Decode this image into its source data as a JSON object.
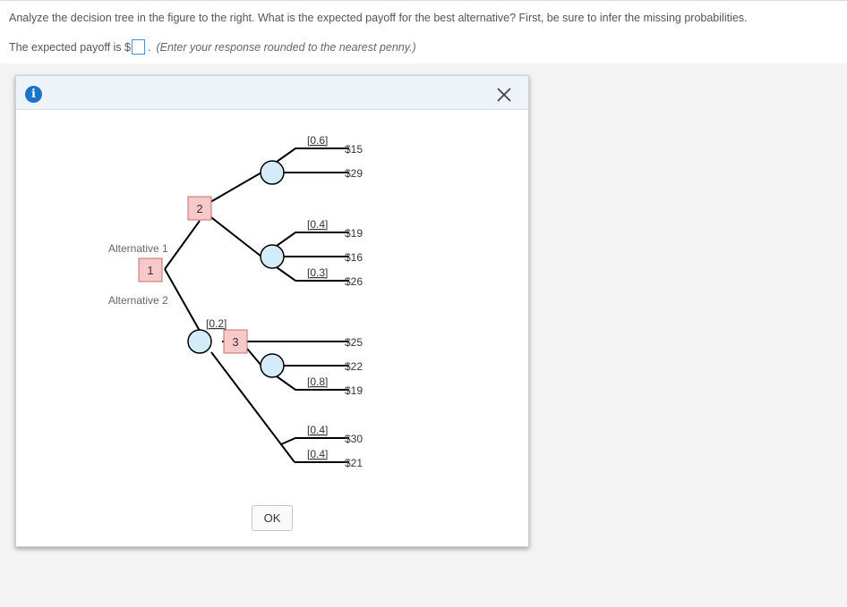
{
  "question": {
    "text": "Analyze the decision tree in the figure to the right. What is the expected payoff for the best alternative? First, be sure to infer the missing probabilities.",
    "answer_prefix": "The expected payoff is $",
    "answer_suffix": ".",
    "answer_value": "",
    "hint": "(Enter your response rounded to the nearest penny.)"
  },
  "dialog": {
    "info_icon_glyph": "i",
    "ok_label": "OK"
  },
  "tree": {
    "decision_nodes": {
      "node1": "1",
      "node2": "2",
      "node3": "3"
    },
    "alternatives": {
      "alt1": "Alternative 1",
      "alt2": "Alternative 2"
    },
    "probabilities": {
      "p_upper_top": "[0.6]",
      "p_middle_top": "[0.4]",
      "p_middle_bottom": "[0.3]",
      "p_alt2": "[0.2]",
      "p_node3_bottom": "[0.8]",
      "p_lower_top": "[0.4]",
      "p_lower_bottom": "[0.4]"
    },
    "payoffs": {
      "pay1": "$15",
      "pay2": "$29",
      "pay3": "$19",
      "pay4": "$16",
      "pay5": "$26",
      "pay6": "$25",
      "pay7": "$22",
      "pay8": "$19",
      "pay9": "$30",
      "pay10": "$21"
    }
  },
  "colors": {
    "decision_node_fill": "#f8c9c9",
    "decision_node_stroke": "#c07070",
    "chance_node_fill": "#d4ecfa",
    "accent_blue": "#1a73c9"
  }
}
